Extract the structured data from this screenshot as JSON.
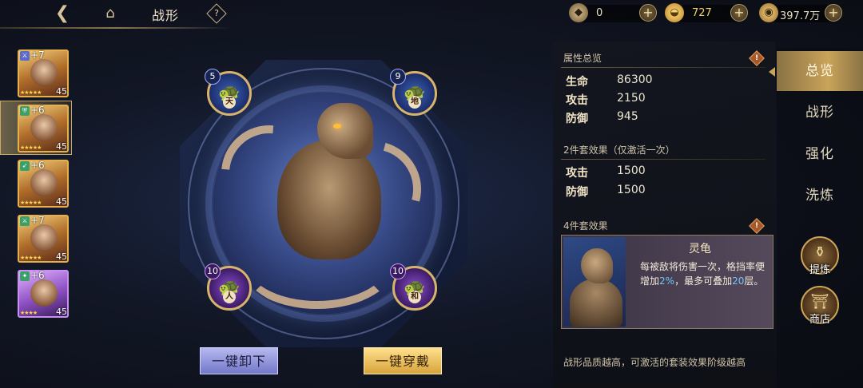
{
  "header": {
    "title": "战形",
    "help_icon": "?"
  },
  "currencies": [
    {
      "icon": "token-icon",
      "value": "0"
    },
    {
      "icon": "ingot-icon",
      "value": "727"
    },
    {
      "icon": "coin-icon",
      "value": "397.7万"
    }
  ],
  "heroes": [
    {
      "plus": "+7",
      "level": "45",
      "stars": "★★★★★",
      "rarity": "gold"
    },
    {
      "plus": "+6",
      "level": "45",
      "stars": "★★★★★",
      "rarity": "gold"
    },
    {
      "plus": "+6",
      "level": "45",
      "stars": "★★★★★",
      "rarity": "gold"
    },
    {
      "plus": "+7",
      "level": "45",
      "stars": "★★★★★",
      "rarity": "gold"
    },
    {
      "plus": "+6",
      "level": "45",
      "stars": "★★★★",
      "rarity": "purple"
    }
  ],
  "slots": [
    {
      "level": "5",
      "char": "天",
      "color": "blue"
    },
    {
      "level": "9",
      "char": "地",
      "color": "blue"
    },
    {
      "level": "10",
      "char": "人",
      "color": "purple"
    },
    {
      "level": "10",
      "char": "和",
      "color": "purple"
    }
  ],
  "buttons": {
    "unequip_all": "一键卸下",
    "equip_all": "一键穿戴"
  },
  "panel": {
    "overview_title": "属性总览",
    "stats": [
      {
        "label": "生命",
        "value": "86300"
      },
      {
        "label": "攻击",
        "value": "2150"
      },
      {
        "label": "防御",
        "value": "945"
      }
    ],
    "set2_title": "2件套效果（仅激活一次）",
    "set2_stats": [
      {
        "label": "攻击",
        "value": "1500"
      },
      {
        "label": "防御",
        "value": "1500"
      }
    ],
    "set4_title": "4件套效果",
    "set4": {
      "name": "灵龟",
      "desc_1": "每被敌将伤害一次，格挡率便增加",
      "desc_hl1": "2%",
      "desc_2": "，最多可叠加",
      "desc_hl2": "20",
      "desc_3": "层。"
    },
    "footer": "战形品质越高，可激活的套装效果阶级越高"
  },
  "tabs": [
    "总览",
    "战形",
    "强化",
    "洗炼"
  ],
  "side_buttons": [
    {
      "label": "提炼",
      "icon": "cauldron-icon"
    },
    {
      "label": "商店",
      "icon": "shop-icon"
    }
  ],
  "colors": {
    "accent_gold": "#c9a45a",
    "highlight_blue": "#6ec6ff"
  }
}
